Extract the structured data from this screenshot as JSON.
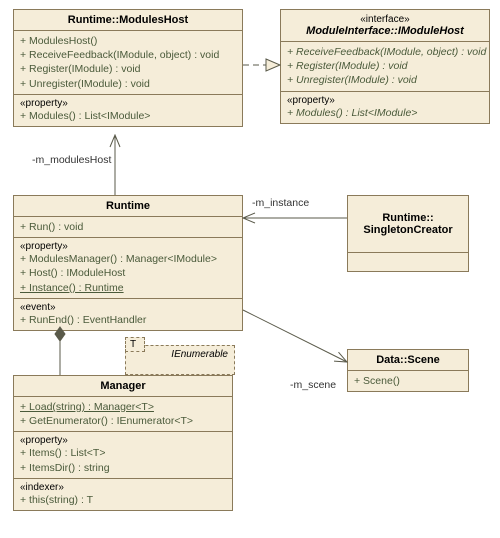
{
  "modulesHost": {
    "name": "Runtime::ModulesHost",
    "ops": [
      "+  ModulesHost()",
      "+  ReceiveFeedback(IModule, object) : void",
      "+  Register(IModule) : void",
      "+  Unregister(IModule) : void"
    ],
    "propStereo": "«property»",
    "props": [
      "+  Modules() : List<IModule>"
    ]
  },
  "iModuleHost": {
    "stereo": "«interface»",
    "name": "ModuleInterface::IModuleHost",
    "ops": [
      "+  ReceiveFeedback(IModule, object) : void",
      "+  Register(IModule) : void",
      "+  Unregister(IModule) : void"
    ],
    "propStereo": "«property»",
    "props": [
      "+  Modules() : List<IModule>"
    ]
  },
  "runtime": {
    "name": "Runtime",
    "ops": [
      "+  Run() : void"
    ],
    "propStereo": "«property»",
    "props": [
      "+  ModulesManager() : Manager<IModule>",
      "+  Host() : IModuleHost",
      "+  Instance() : Runtime"
    ],
    "evtStereo": "«event»",
    "evts": [
      "+  RunEnd() : EventHandler"
    ]
  },
  "singleton": {
    "name": "Runtime::\nSingletonCreator"
  },
  "scene": {
    "name": "Data::Scene",
    "ops": [
      "+  Scene()"
    ]
  },
  "manager": {
    "name": "Manager",
    "ienum": "IEnumerable",
    "tparam": "T",
    "ops": [
      "+  Load(string) : Manager<T>",
      "+  GetEnumerator() : IEnumerator<T>"
    ],
    "propStereo": "«property»",
    "props": [
      "+  Items() : List<T>",
      "+  ItemsDir() : string"
    ],
    "idxStereo": "«indexer»",
    "idx": [
      "+  this(string) : T"
    ]
  },
  "labels": {
    "m_modulesHost": "-m_modulesHost",
    "m_instance": "-m_instance",
    "m_scene": "-m_scene"
  }
}
